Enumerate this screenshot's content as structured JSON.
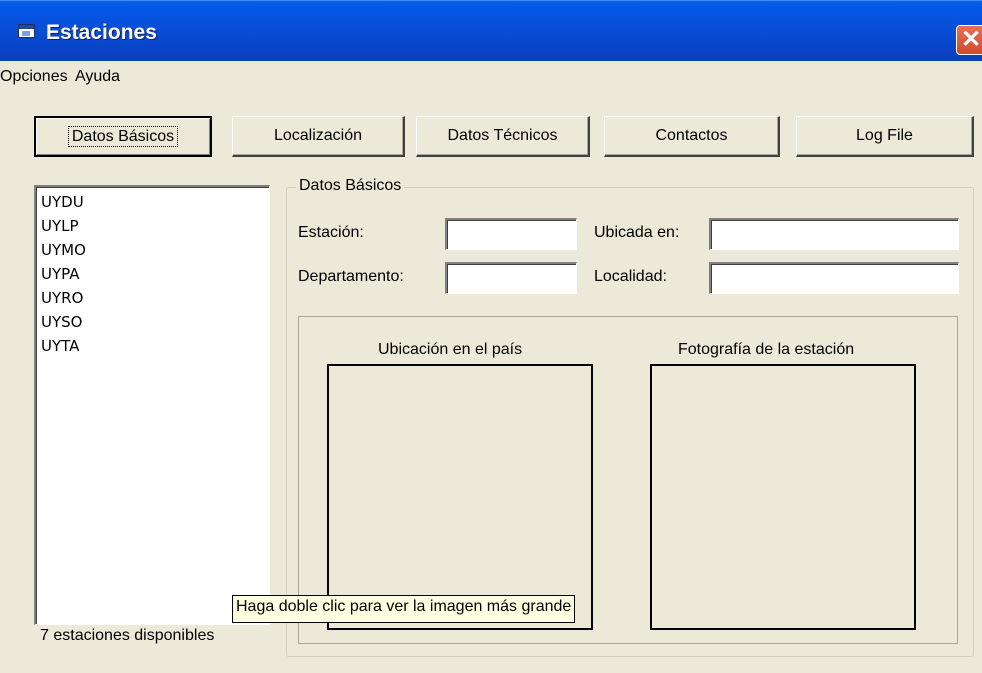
{
  "window": {
    "title": "Estaciones",
    "close_glyph": "✕"
  },
  "menu": {
    "items": [
      "Opciones",
      "Ayuda"
    ]
  },
  "tabs": [
    {
      "label": "Datos Básicos"
    },
    {
      "label": "Localización"
    },
    {
      "label": "Datos Técnicos"
    },
    {
      "label": "Contactos"
    },
    {
      "label": "Log File"
    }
  ],
  "stations": {
    "items": [
      "UYDU",
      "UYLP",
      "UYMO",
      "UYPA",
      "UYRO",
      "UYSO",
      "UYTA"
    ],
    "count_text": "7 estaciones disponibles"
  },
  "datos_basicos": {
    "legend": "Datos Básicos",
    "estacion_label": "Estación:",
    "estacion_value": "",
    "ubicada_label": "Ubicada en:",
    "ubicada_value": "",
    "departamento_label": "Departamento:",
    "departamento_value": "",
    "localidad_label": "Localidad:",
    "localidad_value": ""
  },
  "images": {
    "ubicacion_label": "Ubicación en el país",
    "foto_label": "Fotografía de la estación"
  },
  "tooltip": {
    "text": "Haga doble clic para ver la imagen más grande"
  },
  "colors": {
    "window_bg": "#ece9d8",
    "titlebar": "#0a4fd8",
    "close": "#d24b2c",
    "tooltip_bg": "#ffffe1"
  }
}
